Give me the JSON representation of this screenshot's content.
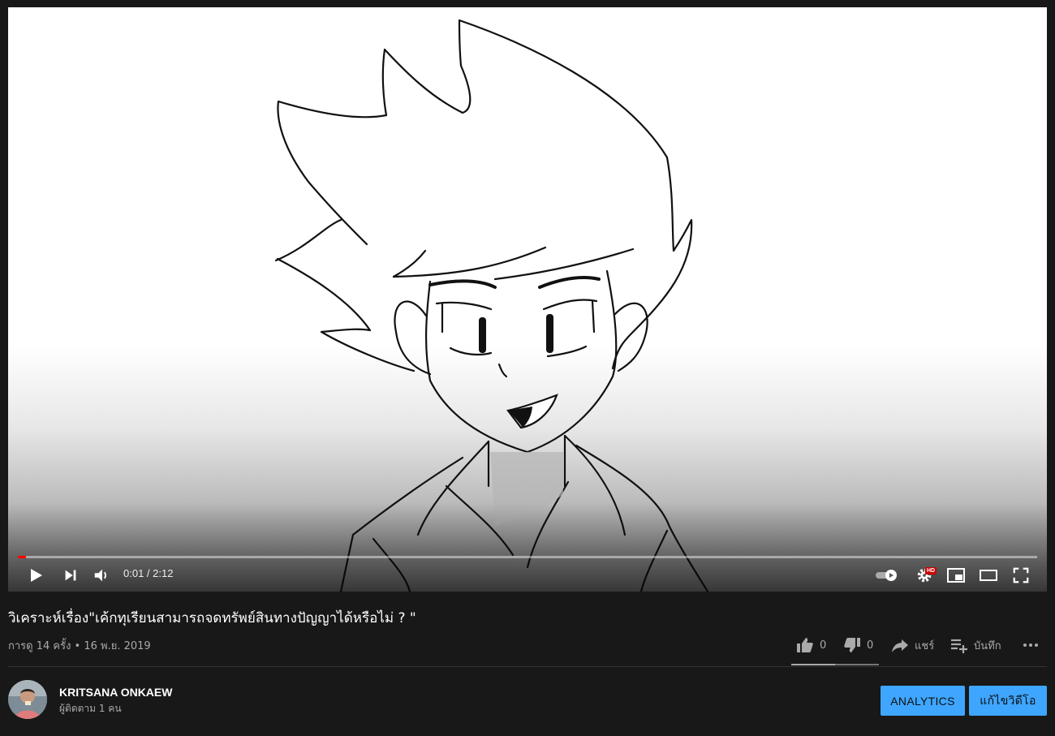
{
  "video": {
    "time_current": "0:01",
    "time_total": "2:12",
    "progress_fraction": 0.008,
    "quality_badge": "HD"
  },
  "info": {
    "title": "วิเคราะห์เรื่อง\"เค้กทุเรียนสามารถจดทรัพย์สินทางปัญญาได้หรือไม่ ? \"",
    "views_date": "การดู 14 ครั้ง • 16 พ.ย. 2019",
    "likes": "0",
    "dislikes": "0",
    "share_label": "แชร์",
    "save_label": "บันทึก",
    "sentiment_like_fraction": 0.5
  },
  "channel": {
    "name": "KRITSANA ONKAEW",
    "subscribers": "ผู้ติดตาม 1 คน",
    "analytics_label": "ANALYTICS",
    "edit_label": "แก้ไขวิดีโอ"
  },
  "colors": {
    "background": "#181818",
    "accent_blue": "#3ea6ff",
    "progress_red": "#ff0000"
  },
  "icons": [
    "play-icon",
    "next-icon",
    "volume-icon",
    "autoplay-toggle-icon",
    "settings-icon",
    "miniplayer-icon",
    "theater-icon",
    "fullscreen-icon",
    "thumbs-up-icon",
    "thumbs-down-icon",
    "share-icon",
    "save-playlist-icon",
    "more-icon"
  ]
}
